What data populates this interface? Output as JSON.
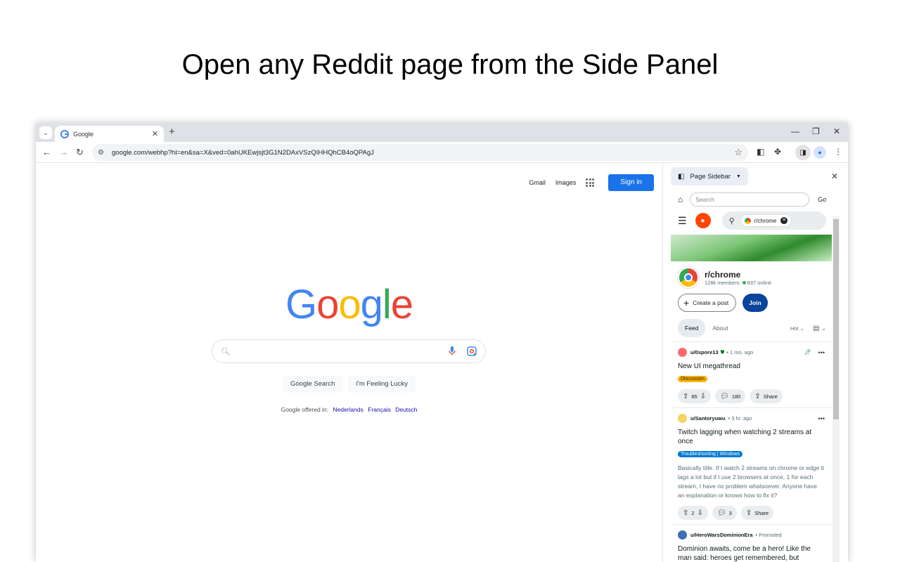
{
  "headline": "Open any Reddit page from the Side Panel",
  "tab": {
    "title": "Google",
    "close": "✕"
  },
  "address": {
    "url": "google.com/webhp?hl=en&sa=X&ved=0ahUKEwjsjt3G1N2DAxVSzQIHHQhCB4oQPAgJ"
  },
  "google": {
    "links": [
      "Gmail",
      "Images"
    ],
    "sign_in": "Sign in",
    "logo": [
      "G",
      "o",
      "o",
      "g",
      "l",
      "e"
    ],
    "logo_colors": [
      "#4285F4",
      "#EA4335",
      "#FBBC05",
      "#4285F4",
      "#34A853",
      "#EA4335"
    ],
    "search_button": "Google Search",
    "lucky_button": "I'm Feeling Lucky",
    "offered_in": "Google offered in:",
    "languages": [
      "Nederlands",
      "Français",
      "Deutsch"
    ]
  },
  "sidepanel": {
    "title": "Page Sidebar",
    "search_placeholder": "Search",
    "go": "Go"
  },
  "reddit": {
    "search_chip": "r/chrome",
    "subreddit": "r/chrome",
    "members": "128k members",
    "online": "837 online",
    "create_post": "Create a post",
    "join": "Join",
    "tabs": [
      "Feed",
      "About"
    ],
    "sort": "Hot",
    "posts": [
      {
        "user": "u/0spore13",
        "time": "• 1 mo. ago",
        "title": "New UI megathread",
        "flair": "Discussion",
        "flair_bg": "#ffb000",
        "flair_fg": "#0f1a1c",
        "votes": "85",
        "comments": "180",
        "share": "Share"
      },
      {
        "user": "u/Santoryuwu",
        "time": "• 3 hr. ago",
        "title": "Twitch lagging when watching 2 streams at once",
        "flair": "Troubleshooting | Windows",
        "flair_bg": "#0079d3",
        "flair_fg": "#ffffff",
        "body": "Basically title. If I watch 2 streams on chrome or edge it lags a lot but if I use 2 browsers at once, 1 for each stream, I have no problem whatsoever. Anyone have an explanation or knows how to fix it?",
        "votes": "2",
        "comments": "3",
        "share": "Share"
      },
      {
        "user": "u/HeroWarsDominionEra",
        "time": "• Promoted",
        "title": "Dominion awaits, come be a hero! Like the man said: heroes get remembered, but legends never die."
      }
    ]
  }
}
